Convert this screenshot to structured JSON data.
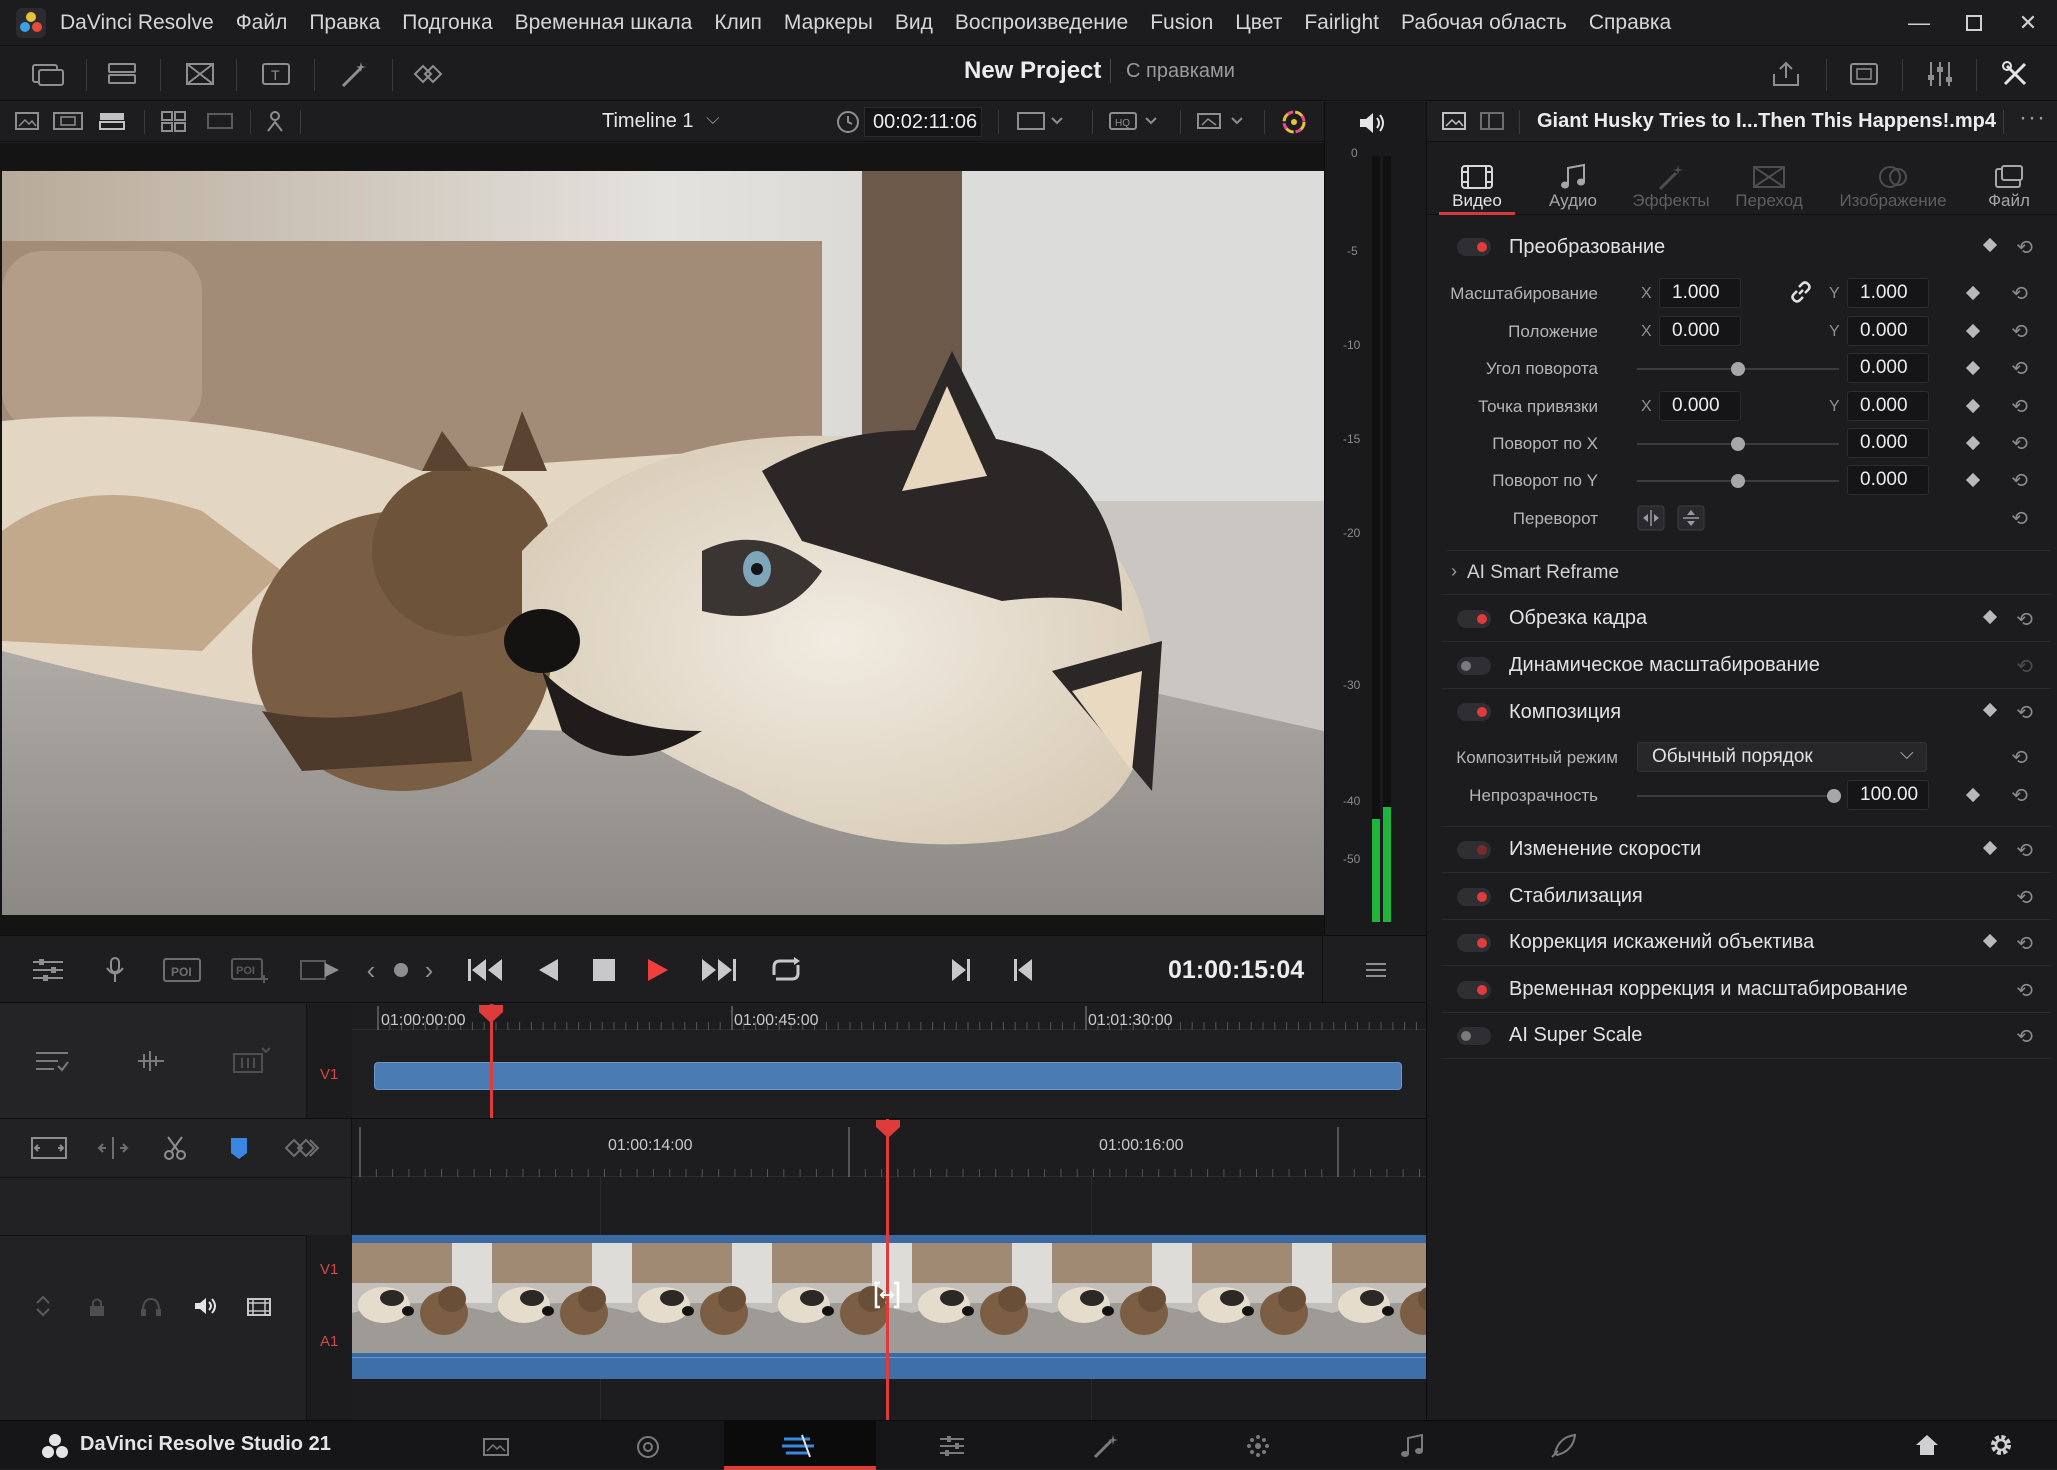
{
  "app": {
    "name": "DaVinci Resolve",
    "footer_name": "DaVinci Resolve Studio 21"
  },
  "menu": [
    "Файл",
    "Правка",
    "Подгонка",
    "Временная шкала",
    "Клип",
    "Маркеры",
    "Вид",
    "Воспроизведение",
    "Fusion",
    "Цвет",
    "Fairlight",
    "Рабочая область",
    "Справка"
  ],
  "project": {
    "title": "New Project",
    "subtitle": "С правками"
  },
  "viewer": {
    "timeline_name": "Timeline 1",
    "timecode": "00:02:11:06",
    "playhead_timecode": "01:00:15:04"
  },
  "meter": {
    "ticks": [
      "0",
      "-5",
      "-10",
      "-15",
      "-20",
      "-30",
      "-40",
      "-50"
    ],
    "level": 0.15
  },
  "timeline_top": {
    "ticks": [
      "01:00:00:00",
      "01:00:45:00",
      "01:01:30:00"
    ],
    "track_label": "V1"
  },
  "timeline_bottom": {
    "ticks": [
      "01:00:14:00",
      "01:00:16:00"
    ],
    "track_labels": [
      "V1",
      "A1"
    ]
  },
  "inspector": {
    "clip_name": "Giant Husky Tries to I...Then This Happens!.mp4",
    "tabs": [
      "Видео",
      "Аудио",
      "Эффекты",
      "Переход",
      "Изображение",
      "Файл"
    ],
    "transform": {
      "title": "Преобразование",
      "scale_label": "Масштабирование",
      "scale_x": "1.000",
      "scale_y": "1.000",
      "position_label": "Положение",
      "position_x": "0.000",
      "position_y": "0.000",
      "rotation_label": "Угол поворота",
      "rotation": "0.000",
      "anchor_label": "Точка привязки",
      "anchor_x": "0.000",
      "anchor_y": "0.000",
      "pitch_label": "Поворот по X",
      "pitch": "0.000",
      "yaw_label": "Поворот по Y",
      "yaw": "0.000",
      "flip_label": "Переворот",
      "x": "X",
      "y": "Y"
    },
    "smart_reframe": "AI Smart Reframe",
    "sections": {
      "crop": "Обрезка кадра",
      "dynamic_zoom": "Динамическое масштабирование",
      "composite": "Композиция",
      "speed": "Изменение скорости",
      "stabilization": "Стабилизация",
      "lens": "Коррекция искажений объектива",
      "retime": "Временная коррекция и масштабирование",
      "superscale": "AI Super Scale"
    },
    "composite": {
      "mode_label": "Композитный режим",
      "mode_value": "Обычный порядок",
      "opacity_label": "Непрозрачность",
      "opacity": "100.00"
    }
  }
}
